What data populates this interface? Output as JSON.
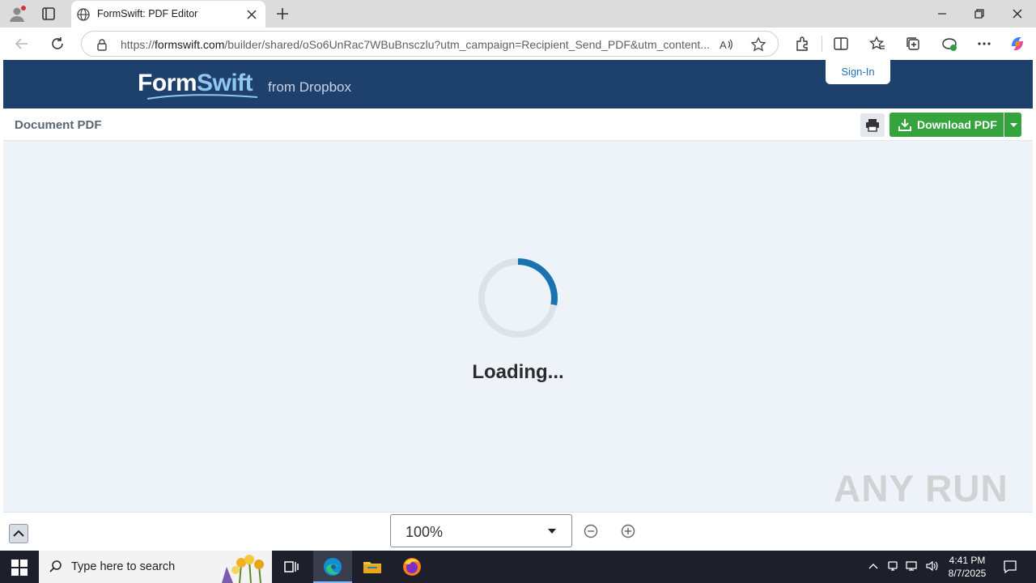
{
  "browser": {
    "tab_title": "FormSwift: PDF Editor",
    "url_domain": "formswift.com",
    "url_prefix": "https://",
    "url_rest": "/builder/shared/oSo6UnRac7WBuBnsczlu?utm_campaign=Recipient_Send_PDF&utm_content..."
  },
  "site": {
    "logo_text_form": "Form",
    "logo_text_swift": "Swift",
    "logo_from": "from Dropbox",
    "signin_label": "Sign-In"
  },
  "document": {
    "title": "Document PDF",
    "download_label": "Download PDF",
    "loading_text": "Loading...",
    "loading_progress": 0.28
  },
  "viewer": {
    "zoom_value": "100%"
  },
  "watermark": "ANY RUN",
  "taskbar": {
    "search_placeholder": "Type here to search",
    "time": "4:41 PM",
    "date": "8/7/2025"
  },
  "colors": {
    "header_bg": "#1e406d",
    "download_green": "#36a43d",
    "spinner_blue": "#1a73b0"
  }
}
